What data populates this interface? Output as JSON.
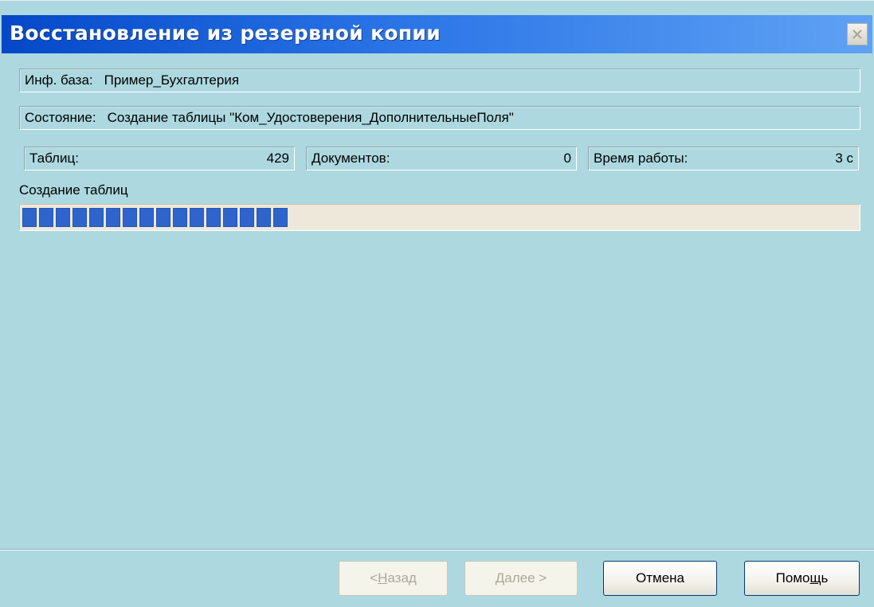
{
  "window": {
    "title": "Восстановление из резервной копии",
    "close_icon": "close-icon"
  },
  "info_base": {
    "label": "Инф. база:",
    "value": "Пример_Бухгалтерия"
  },
  "status": {
    "label": "Состояние:",
    "value": "Создание таблицы \"Ком_Удостоверения_ДополнительныеПоля\""
  },
  "stats": {
    "tables_label": "Таблиц:",
    "tables_value": "429",
    "documents_label": "Документов:",
    "documents_value": "0",
    "time_label": "Время работы:",
    "time_value": "3 с"
  },
  "progress": {
    "label": "Создание таблиц",
    "fraction": 0.31,
    "color": "#2e64cc"
  },
  "buttons": {
    "back_pre": "< ",
    "back_key": "Н",
    "back_post": "азад",
    "next_key": "Д",
    "next_post": "алее >",
    "cancel": "Отмена",
    "help_pre": "Помо",
    "help_key": "щ",
    "help_post": "ь"
  },
  "colors": {
    "titlebar_start": "#0448c8",
    "titlebar_end": "#5fa2f4",
    "background": "#add8e0"
  }
}
